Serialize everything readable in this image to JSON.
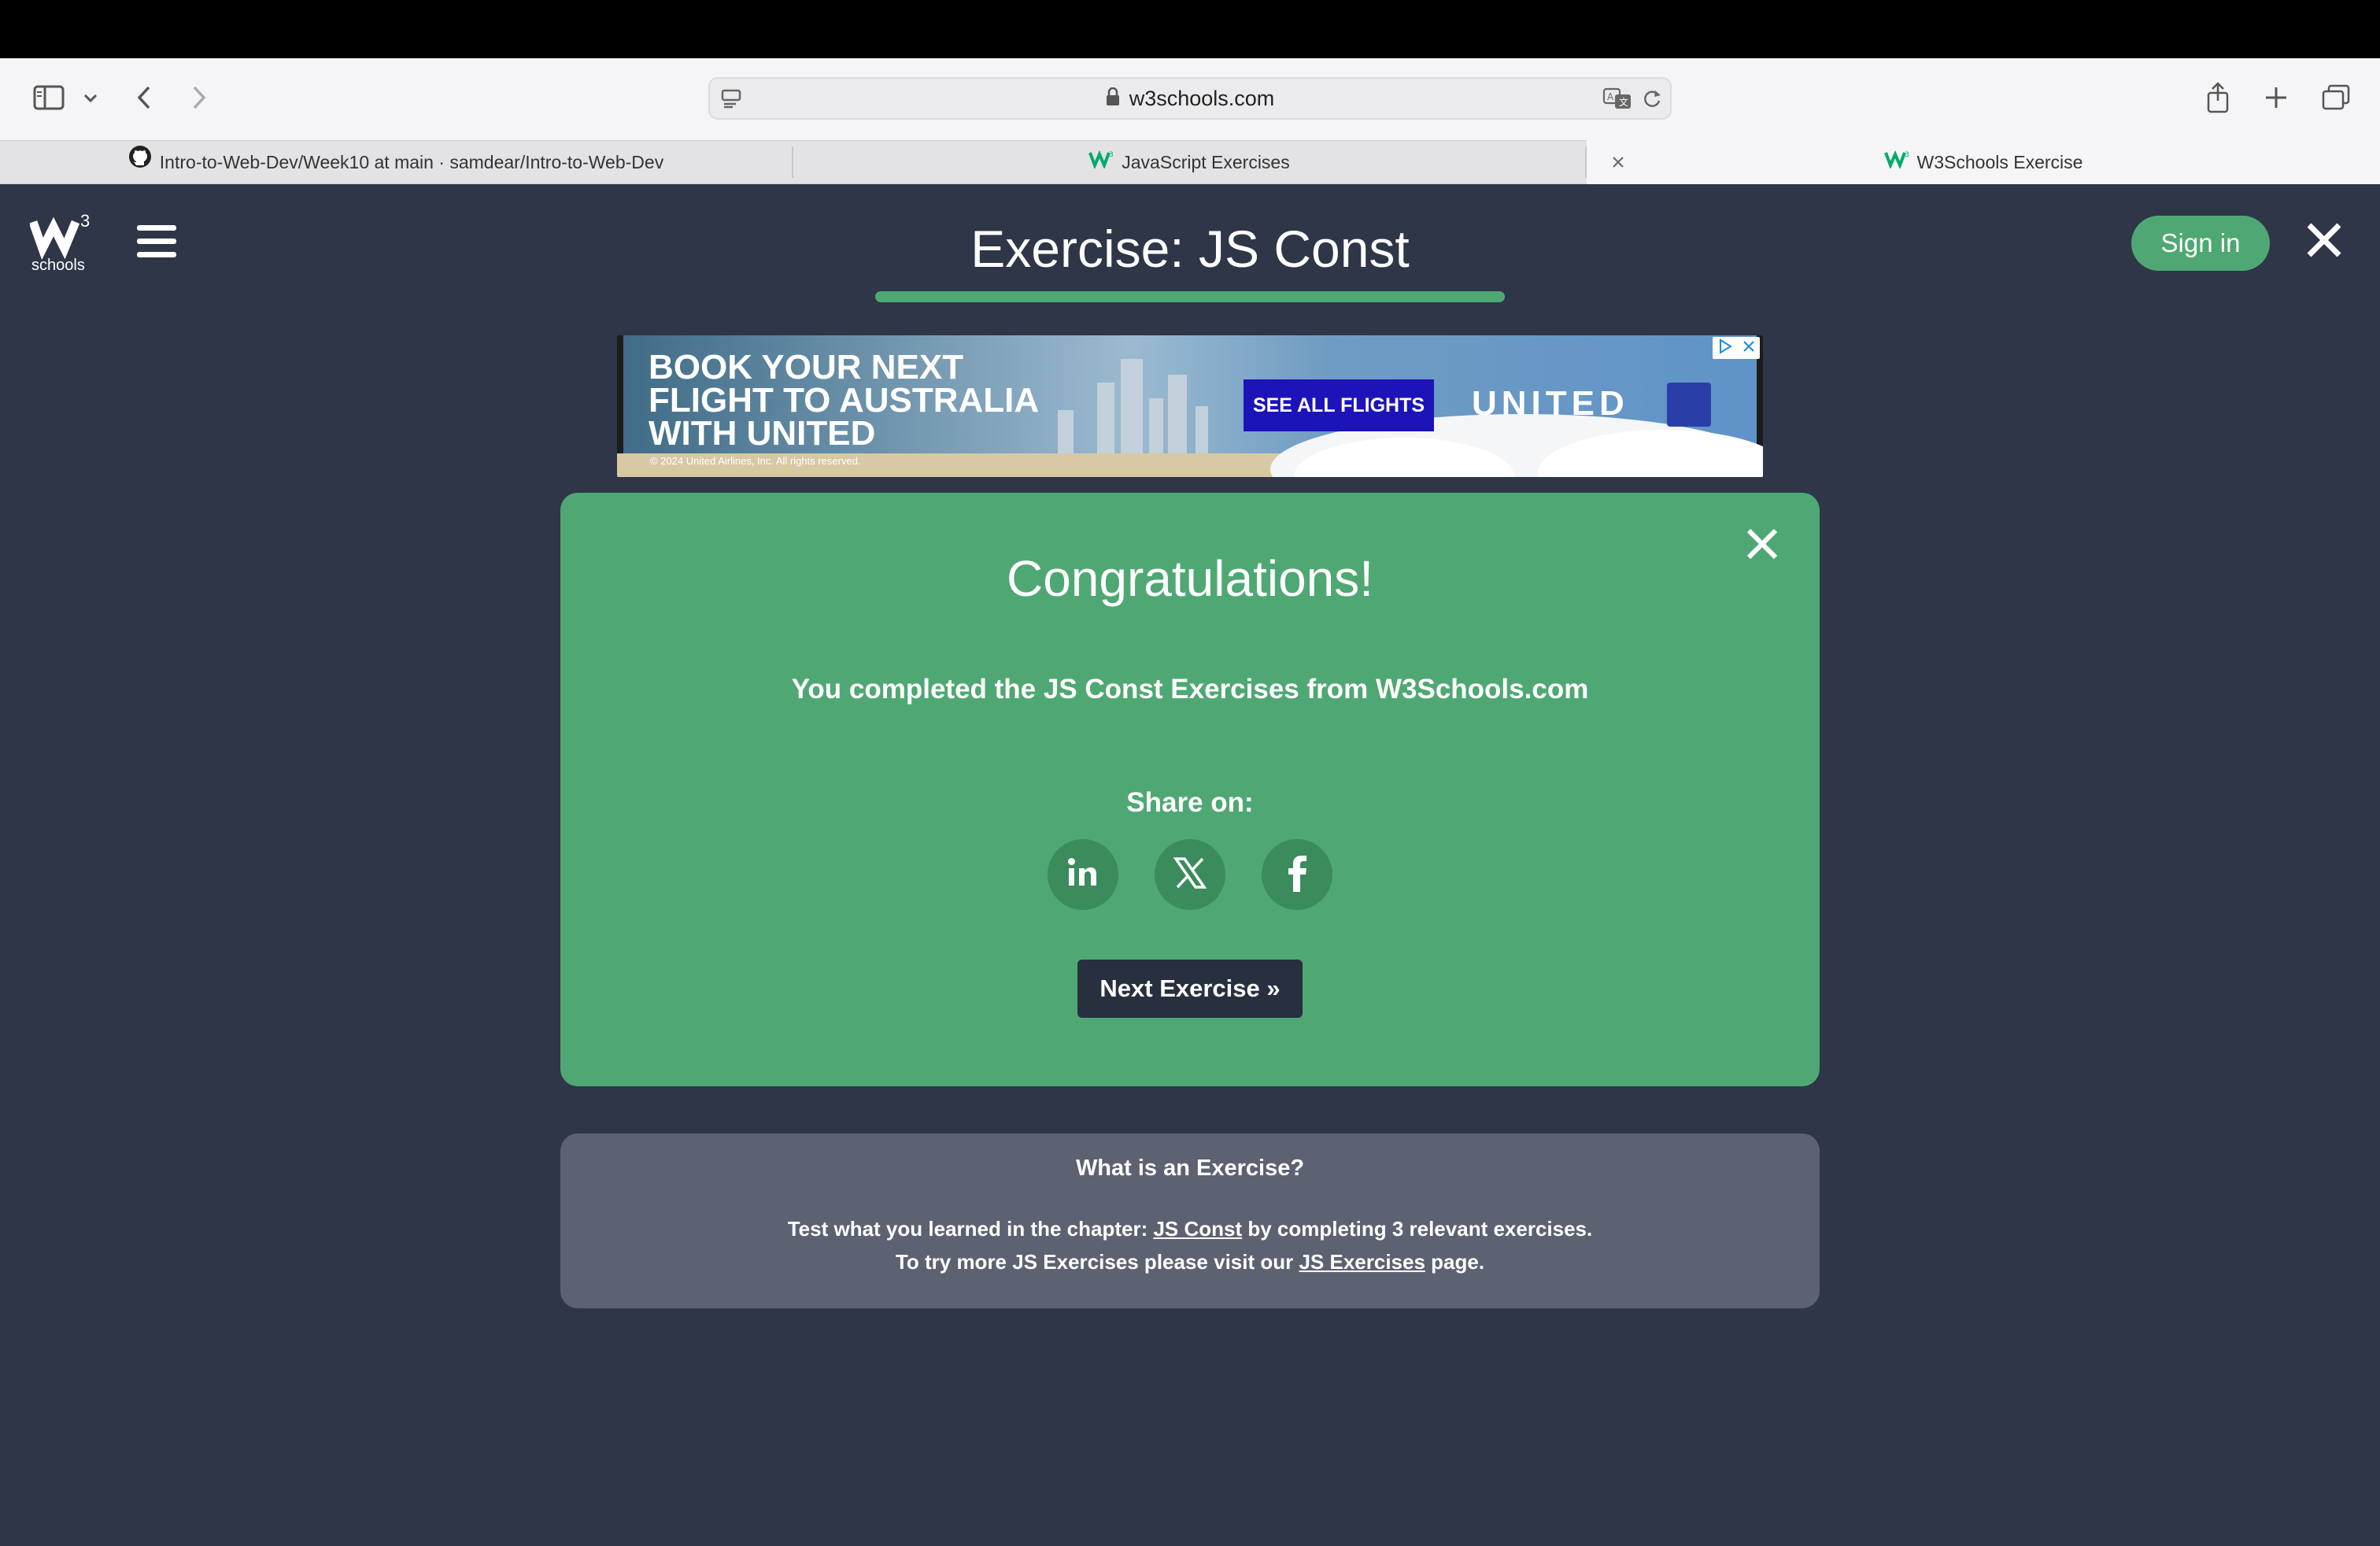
{
  "browser": {
    "url": "w3schools.com",
    "tabs": [
      {
        "label": "Intro-to-Web-Dev/Week10 at main · samdear/Intro-to-Web-Dev",
        "icon": "github-icon"
      },
      {
        "label": "JavaScript Exercises",
        "icon": "w3schools-icon"
      },
      {
        "label": "W3Schools Exercise",
        "icon": "w3schools-icon",
        "active": true
      }
    ]
  },
  "header": {
    "logo_text": "schools",
    "logo_sup": "3",
    "title": "Exercise: JS Const",
    "signin_label": "Sign in",
    "progress": 1.0
  },
  "ad": {
    "headline_1": "BOOK YOUR NEXT",
    "headline_2": "FLIGHT TO AUSTRALIA",
    "headline_3": "WITH UNITED",
    "copyright": "© 2024 United Airlines, Inc. All rights reserved.",
    "cta": "SEE ALL FLIGHTS",
    "brand": "UNITED"
  },
  "result": {
    "title": "Congratulations!",
    "message": "You completed the JS Const Exercises from W3Schools.com",
    "share_label": "Share on:",
    "share_icons": [
      "linkedin-icon",
      "x-icon",
      "facebook-icon"
    ],
    "next_label": "Next Exercise »"
  },
  "info": {
    "title": "What is an Exercise?",
    "line1_pre": "Test what you learned in the chapter: ",
    "line1_link": "JS Const",
    "line1_post": " by completing 3 relevant exercises.",
    "line2_pre": "To try more JS Exercises please visit our ",
    "line2_link": "JS Exercises",
    "line2_post": " page."
  },
  "colors": {
    "background": "#2f3647",
    "accent": "#4fa873",
    "info_card": "#5c6271",
    "next_button": "#282f3e"
  }
}
